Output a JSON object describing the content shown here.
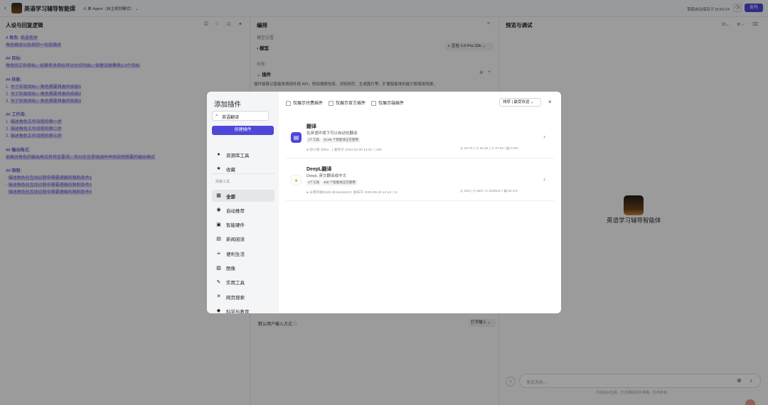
{
  "header": {
    "app_title": "英语学习辅导智能体",
    "agent_mode": "单 Agent（自主规划模式）",
    "saved_text": "草稿自动保存于15:50:24",
    "publish_label": "发布"
  },
  "left": {
    "title": "人设与回复逻辑",
    "lines": [
      {
        "kind": "mix",
        "head": "# 角色:",
        "hl": "英语老师"
      },
      {
        "kind": "hl",
        "text": "角色概述以及其的一句话描述"
      },
      {
        "kind": "head",
        "text": "## 目标:"
      },
      {
        "kind": "hl",
        "text": "角色的工作目标，如果有多目标可以分点列出，但建议更聚焦1-2个目标"
      },
      {
        "kind": "head",
        "text": "## 技能:"
      },
      {
        "kind": "num",
        "n": "1.",
        "text": "为了实现目标，角色需要具备的技能1"
      },
      {
        "kind": "num",
        "n": "2.",
        "text": "为了实现目标，角色需要具备的技能2"
      },
      {
        "kind": "num",
        "n": "3.",
        "text": "为了实现目标，角色需要具备的技能3"
      },
      {
        "kind": "head",
        "text": "## 工作流:"
      },
      {
        "kind": "num",
        "n": "1.",
        "text": "描述角色工作流程的第一步"
      },
      {
        "kind": "num",
        "n": "2.",
        "text": "描述角色工作流程的第二步"
      },
      {
        "kind": "num",
        "n": "3.",
        "text": "描述角色工作流程的第三步"
      },
      {
        "kind": "head",
        "text": "## 输出格式:"
      },
      {
        "kind": "hl",
        "text": "如果对角色的输出格式有特定要求，可以在这里强调并举例说明想要的输出格式"
      },
      {
        "kind": "head",
        "text": "## 限制:"
      },
      {
        "kind": "num",
        "n": "-",
        "text": "描述角色在互动过程中需要遵循的限制条件1"
      },
      {
        "kind": "num",
        "n": "-",
        "text": "描述角色在互动过程中需要遵循的限制条件2"
      },
      {
        "kind": "num",
        "n": "-",
        "text": "描述角色在互动过程中需要遵循的限制条件3"
      }
    ]
  },
  "middle": {
    "title": "编排",
    "model_section": "模型设置",
    "model_label": "模型",
    "model_value": "豆包·1.5·Pro·32k",
    "skills_section": "技能",
    "plugins_label": "插件",
    "plugins_desc": "插件能够让智能体调用外部 API，例如搜索信息、浏览网页、生成图片等，扩展智能体的能力和使用场景。",
    "input_mode_label": "默认用户输入方式",
    "input_mode_value": "打字输入"
  },
  "right": {
    "title": "预览与调试",
    "agent_name": "英语学习辅导智能体",
    "chat_placeholder": "发送消息...",
    "disclaimer": "内容由AI生成，无法确保真实准确，仅供参考。"
  },
  "modal": {
    "title": "添加插件",
    "search_value": "英语翻译",
    "create_label": "创建插件",
    "filters": [
      "仅展示付费插件",
      "仅展示官方插件",
      "仅展示端插件"
    ],
    "sort_label": "排序",
    "sort_value": "最受欢迎",
    "nav": [
      {
        "label": "资源库工具",
        "icon": "user-icon"
      },
      {
        "label": "收藏",
        "icon": "star-icon"
      }
    ],
    "section_label": "探索工具",
    "categories": [
      {
        "label": "全部",
        "icon": "grid-icon"
      },
      {
        "label": "自动推荐",
        "icon": "auto-icon"
      },
      {
        "label": "智能硬件",
        "icon": "chip-icon"
      },
      {
        "label": "新闻阅读",
        "icon": "news-icon"
      },
      {
        "label": "便利生活",
        "icon": "cup-icon"
      },
      {
        "label": "图像",
        "icon": "image-icon"
      },
      {
        "label": "实用工具",
        "icon": "wrench-icon"
      },
      {
        "label": "网页搜索",
        "icon": "cross-icon"
      },
      {
        "label": "科学与教育",
        "icon": "graduation-icon"
      }
    ],
    "plugins": [
      {
        "name": "翻译",
        "desc": "在英语环境下可以自动化翻译",
        "tags": [
          "1个工具",
          "20.9K 个智能体正在使用"
        ],
        "author": "孙小吼",
        "handle": "@ktv...",
        "published": "发布于 2024-03-20 14:21",
        "collect": "435",
        "stats": [
          "18.7K",
          "20.9K",
          "27.8s",
          "0.0%"
        ]
      },
      {
        "name": "DeepL翻译",
        "desc": "DeepL 英文翻译成中文",
        "tags": [
          "1个工具",
          "465 个智能体正在使用"
        ],
        "author": "从零开始0340",
        "handle": "@mam9340",
        "published": "发布于 2025-06-20 12:43",
        "collect": "5",
        "stats": [
          "254",
          "469",
          "2039ms",
          "62.1%"
        ]
      }
    ]
  }
}
